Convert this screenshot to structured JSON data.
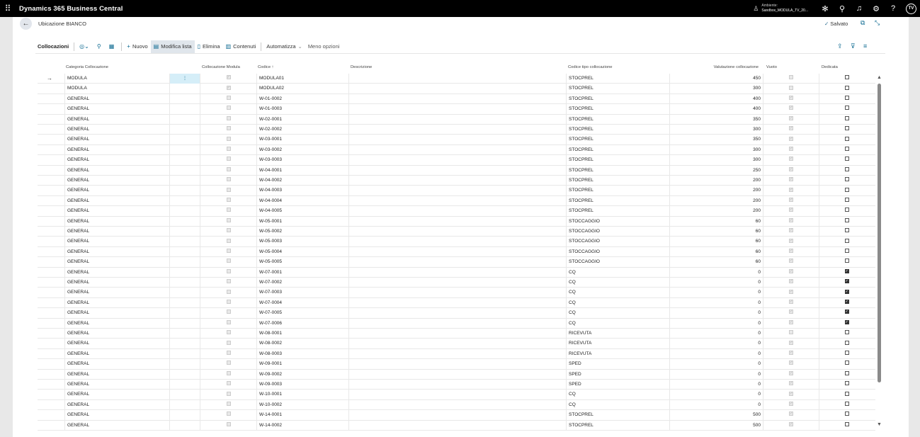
{
  "topbar": {
    "app_title": "Dynamics 365 Business Central",
    "env_label": "Ambiente:",
    "env_name": "Sandbox_MODULA_TV_20...",
    "avatar_initials": "TV"
  },
  "page": {
    "title": "Ubicazione BIANCO",
    "saved_label": "Salvato"
  },
  "actions": {
    "tab": "Collocazioni",
    "new": "Nuovo",
    "edit_list": "Modifica lista",
    "delete": "Elimina",
    "contents": "Contenuti",
    "automate": "Automatizza",
    "fewer_options": "Meno opzioni"
  },
  "columns": {
    "categoria": "Categoria Collocazione",
    "coll_modula": "Collocazione Modula",
    "codice": "Codice ↑",
    "descrizione": "Descrizione",
    "tipo": "Codice tipo collocazione",
    "valutazione": "Valutazione collocazione",
    "vuoto": "Vuoto",
    "dedicata": "Dedicata"
  },
  "rows": [
    {
      "categoria": "MODULA",
      "modula": true,
      "codice": "MODULA01",
      "descrizione": "",
      "tipo": "STOCPREL",
      "valutazione": "450",
      "vuoto": false,
      "dedicata": false
    },
    {
      "categoria": "MODULA",
      "modula": true,
      "codice": "MODULA02",
      "descrizione": "",
      "tipo": "STOCPREL",
      "valutazione": "300",
      "vuoto": false,
      "dedicata": false
    },
    {
      "categoria": "GENERAL",
      "modula": false,
      "codice": "W-01-0002",
      "descrizione": "",
      "tipo": "STOCPREL",
      "valutazione": "400",
      "vuoto": true,
      "dedicata": false
    },
    {
      "categoria": "GENERAL",
      "modula": false,
      "codice": "W-01-0003",
      "descrizione": "",
      "tipo": "STOCPREL",
      "valutazione": "400",
      "vuoto": true,
      "dedicata": false
    },
    {
      "categoria": "GENERAL",
      "modula": false,
      "codice": "W-02-0001",
      "descrizione": "",
      "tipo": "STOCPREL",
      "valutazione": "350",
      "vuoto": true,
      "dedicata": false
    },
    {
      "categoria": "GENERAL",
      "modula": false,
      "codice": "W-02-0002",
      "descrizione": "",
      "tipo": "STOCPREL",
      "valutazione": "300",
      "vuoto": true,
      "dedicata": false
    },
    {
      "categoria": "GENERAL",
      "modula": false,
      "codice": "W-03-0001",
      "descrizione": "",
      "tipo": "STOCPREL",
      "valutazione": "350",
      "vuoto": true,
      "dedicata": false
    },
    {
      "categoria": "GENERAL",
      "modula": false,
      "codice": "W-03-0002",
      "descrizione": "",
      "tipo": "STOCPREL",
      "valutazione": "300",
      "vuoto": true,
      "dedicata": false
    },
    {
      "categoria": "GENERAL",
      "modula": false,
      "codice": "W-03-0003",
      "descrizione": "",
      "tipo": "STOCPREL",
      "valutazione": "300",
      "vuoto": true,
      "dedicata": false
    },
    {
      "categoria": "GENERAL",
      "modula": false,
      "codice": "W-04-0001",
      "descrizione": "",
      "tipo": "STOCPREL",
      "valutazione": "250",
      "vuoto": true,
      "dedicata": false
    },
    {
      "categoria": "GENERAL",
      "modula": false,
      "codice": "W-04-0002",
      "descrizione": "",
      "tipo": "STOCPREL",
      "valutazione": "200",
      "vuoto": true,
      "dedicata": false
    },
    {
      "categoria": "GENERAL",
      "modula": false,
      "codice": "W-04-0003",
      "descrizione": "",
      "tipo": "STOCPREL",
      "valutazione": "200",
      "vuoto": true,
      "dedicata": false
    },
    {
      "categoria": "GENERAL",
      "modula": false,
      "codice": "W-04-0004",
      "descrizione": "",
      "tipo": "STOCPREL",
      "valutazione": "200",
      "vuoto": true,
      "dedicata": false
    },
    {
      "categoria": "GENERAL",
      "modula": false,
      "codice": "W-04-0005",
      "descrizione": "",
      "tipo": "STOCPREL",
      "valutazione": "200",
      "vuoto": true,
      "dedicata": false
    },
    {
      "categoria": "GENERAL",
      "modula": false,
      "codice": "W-05-0001",
      "descrizione": "",
      "tipo": "STOCCAGGIO",
      "valutazione": "60",
      "vuoto": true,
      "dedicata": false
    },
    {
      "categoria": "GENERAL",
      "modula": false,
      "codice": "W-05-0002",
      "descrizione": "",
      "tipo": "STOCCAGGIO",
      "valutazione": "60",
      "vuoto": true,
      "dedicata": false
    },
    {
      "categoria": "GENERAL",
      "modula": false,
      "codice": "W-05-0003",
      "descrizione": "",
      "tipo": "STOCCAGGIO",
      "valutazione": "60",
      "vuoto": true,
      "dedicata": false
    },
    {
      "categoria": "GENERAL",
      "modula": false,
      "codice": "W-05-0004",
      "descrizione": "",
      "tipo": "STOCCAGGIO",
      "valutazione": "60",
      "vuoto": true,
      "dedicata": false
    },
    {
      "categoria": "GENERAL",
      "modula": false,
      "codice": "W-05-0005",
      "descrizione": "",
      "tipo": "STOCCAGGIO",
      "valutazione": "60",
      "vuoto": true,
      "dedicata": false
    },
    {
      "categoria": "GENERAL",
      "modula": false,
      "codice": "W-07-0001",
      "descrizione": "",
      "tipo": "CQ",
      "valutazione": "0",
      "vuoto": true,
      "dedicata": true
    },
    {
      "categoria": "GENERAL",
      "modula": false,
      "codice": "W-07-0002",
      "descrizione": "",
      "tipo": "CQ",
      "valutazione": "0",
      "vuoto": true,
      "dedicata": true
    },
    {
      "categoria": "GENERAL",
      "modula": false,
      "codice": "W-07-0003",
      "descrizione": "",
      "tipo": "CQ",
      "valutazione": "0",
      "vuoto": true,
      "dedicata": true
    },
    {
      "categoria": "GENERAL",
      "modula": false,
      "codice": "W-07-0004",
      "descrizione": "",
      "tipo": "CQ",
      "valutazione": "0",
      "vuoto": true,
      "dedicata": true
    },
    {
      "categoria": "GENERAL",
      "modula": false,
      "codice": "W-07-0005",
      "descrizione": "",
      "tipo": "CQ",
      "valutazione": "0",
      "vuoto": true,
      "dedicata": true
    },
    {
      "categoria": "GENERAL",
      "modula": false,
      "codice": "W-07-0006",
      "descrizione": "",
      "tipo": "CQ",
      "valutazione": "0",
      "vuoto": true,
      "dedicata": true
    },
    {
      "categoria": "GENERAL",
      "modula": false,
      "codice": "W-08-0001",
      "descrizione": "",
      "tipo": "RICEVUTA",
      "valutazione": "0",
      "vuoto": false,
      "dedicata": false
    },
    {
      "categoria": "GENERAL",
      "modula": false,
      "codice": "W-08-0002",
      "descrizione": "",
      "tipo": "RICEVUTA",
      "valutazione": "0",
      "vuoto": true,
      "dedicata": false
    },
    {
      "categoria": "GENERAL",
      "modula": false,
      "codice": "W-08-0003",
      "descrizione": "",
      "tipo": "RICEVUTA",
      "valutazione": "0",
      "vuoto": true,
      "dedicata": false
    },
    {
      "categoria": "GENERAL",
      "modula": false,
      "codice": "W-09-0001",
      "descrizione": "",
      "tipo": "SPED",
      "valutazione": "0",
      "vuoto": true,
      "dedicata": false
    },
    {
      "categoria": "GENERAL",
      "modula": false,
      "codice": "W-09-0002",
      "descrizione": "",
      "tipo": "SPED",
      "valutazione": "0",
      "vuoto": true,
      "dedicata": false
    },
    {
      "categoria": "GENERAL",
      "modula": false,
      "codice": "W-09-0003",
      "descrizione": "",
      "tipo": "SPED",
      "valutazione": "0",
      "vuoto": true,
      "dedicata": false
    },
    {
      "categoria": "GENERAL",
      "modula": false,
      "codice": "W-10-0001",
      "descrizione": "",
      "tipo": "CQ",
      "valutazione": "0",
      "vuoto": true,
      "dedicata": false
    },
    {
      "categoria": "GENERAL",
      "modula": false,
      "codice": "W-10-0002",
      "descrizione": "",
      "tipo": "CQ",
      "valutazione": "0",
      "vuoto": true,
      "dedicata": false
    },
    {
      "categoria": "GENERAL",
      "modula": false,
      "codice": "W-14-0001",
      "descrizione": "",
      "tipo": "STOCPREL",
      "valutazione": "500",
      "vuoto": true,
      "dedicata": false
    },
    {
      "categoria": "GENERAL",
      "modula": false,
      "codice": "W-14-0002",
      "descrizione": "",
      "tipo": "STOCPREL",
      "valutazione": "500",
      "vuoto": true,
      "dedicata": false
    }
  ],
  "icons": {
    "menu_dots": "⋮",
    "current_row": "→"
  }
}
